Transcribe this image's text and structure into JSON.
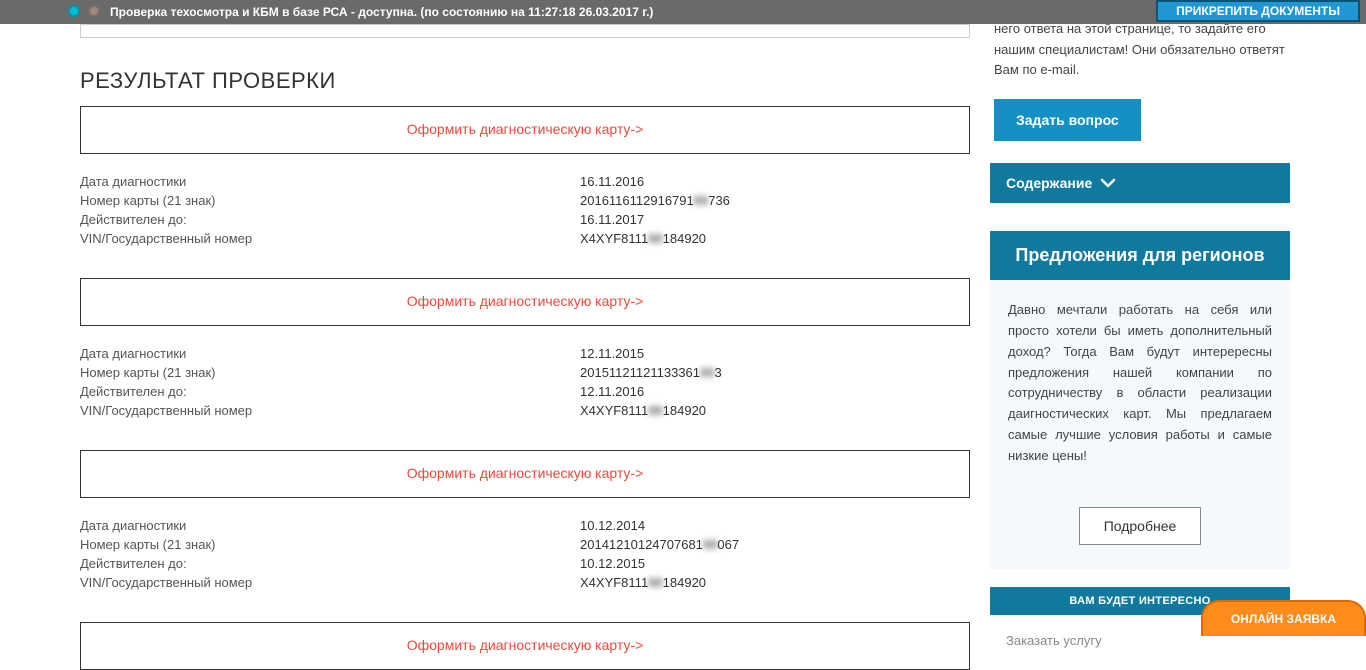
{
  "topbar": {
    "status": "Проверка техосмотра и КБМ в базе РСА - доступна. (по состоянию на 11:27:18 26.03.2017 г.)",
    "attach": "ПРИКРЕПИТЬ ДОКУМЕНТЫ"
  },
  "online_btn": "ОНЛАЙН ЗАЯВКА",
  "main": {
    "section_title": "РЕЗУЛЬТАТ ПРОВЕРКИ",
    "card_link": "Оформить диагностическую карту->",
    "labels": {
      "date": "Дата диагностики",
      "card": "Номер карты (21 знак)",
      "valid": "Действителен до:",
      "vin": "VIN/Государственный номер"
    },
    "records": [
      {
        "date": "16.11.2016",
        "card_a": "2016116112916791",
        "card_b": "736",
        "valid": "16.11.2017",
        "vin_a": "X4XYF8111",
        "vin_b": "184920"
      },
      {
        "date": "12.11.2015",
        "card_a": "20151121121133361",
        "card_b": "3",
        "valid": "12.11.2016",
        "vin_a": "X4XYF8111",
        "vin_b": "184920"
      },
      {
        "date": "10.12.2014",
        "card_a": "20141210124707681",
        "card_b": "067",
        "valid": "10.12.2015",
        "vin_a": "X4XYF8111",
        "vin_b": "184920"
      }
    ]
  },
  "side": {
    "faq_partial": "Если у Вас есть вопросы и Вы не нашли на него ответа на этой странице, то задайте его нашим специалистам! Они обязательно ответят Вам по e-mail.",
    "ask": "Задать вопрос",
    "toc": "Содержание",
    "region_title": "Предложения для регионов",
    "region_body": "Давно мечтали работать на себя или просто хотели бы иметь дополнительный доход? Тогда Вам будут интерересны предложения нашей компании по сотрудничеству в области реализации даигностических карт. Мы предлагаем самые лучшие условия работы и самые низкие цены!",
    "more": "Подробнее",
    "interest": "ВАМ БУДЕТ ИНТЕРЕСНО",
    "foot": "Заказать услугу"
  }
}
